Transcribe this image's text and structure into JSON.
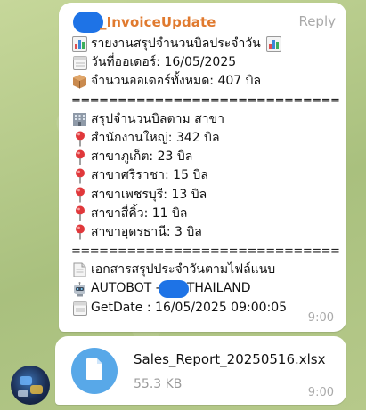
{
  "message1": {
    "sender": "_InvoiceUpdate",
    "reply_label": "Reply",
    "lines": [
      {
        "icon": "bar-chart-icon",
        "text": "รายงานสรุปจำนวนบิลประจำวัน",
        "trail_icon": "bar-chart-icon"
      },
      {
        "icon": "calendar-icon",
        "text": "วันที่ออเดอร์: 16/05/2025"
      },
      {
        "icon": "package-icon",
        "text": "จำนวนออเดอร์ทั้งหมด: 407 บิล"
      },
      {
        "icon": "",
        "text": "==============================",
        "separator": true
      },
      {
        "icon": "office-building-icon",
        "text": "สรุปจำนวนบิลตาม สาขา"
      },
      {
        "icon": "pin-icon",
        "text": "สำนักงานใหญ่: 342 บิล"
      },
      {
        "icon": "pin-icon",
        "text": "สาขาภูเก็ต: 23 บิล"
      },
      {
        "icon": "pin-icon",
        "text": "สาขาศรีราชา: 15 บิล"
      },
      {
        "icon": "pin-icon",
        "text": "สาขาเพชรบุรี: 13 บิล"
      },
      {
        "icon": "pin-icon",
        "text": "สาขาสี่คิ้ว: 11 บิล"
      },
      {
        "icon": "pin-icon",
        "text": "สาขาอุดรธานี: 3 บิล"
      },
      {
        "icon": "",
        "text": "==============================",
        "separator": true
      },
      {
        "icon": "document-icon",
        "text": "เอกสารสรุปประจำวันตามไฟล์แนบ"
      },
      {
        "icon": "robot-icon",
        "text_before": "AUTOBOT -",
        "text_after": "THAILAND",
        "redacted": true
      },
      {
        "icon": "calendar-icon",
        "text": "GetDate : 16/05/2025 09:00:05"
      }
    ],
    "time": "9:00"
  },
  "message2": {
    "file_name": "Sales_Report_20250516.xlsx",
    "file_size": "55.3 KB",
    "time": "9:00"
  },
  "colors": {
    "sender": "#e07a2f",
    "redaction": "#1e73e6",
    "file_icon_bg": "#58a8e8",
    "meta": "#a9a9a9"
  }
}
